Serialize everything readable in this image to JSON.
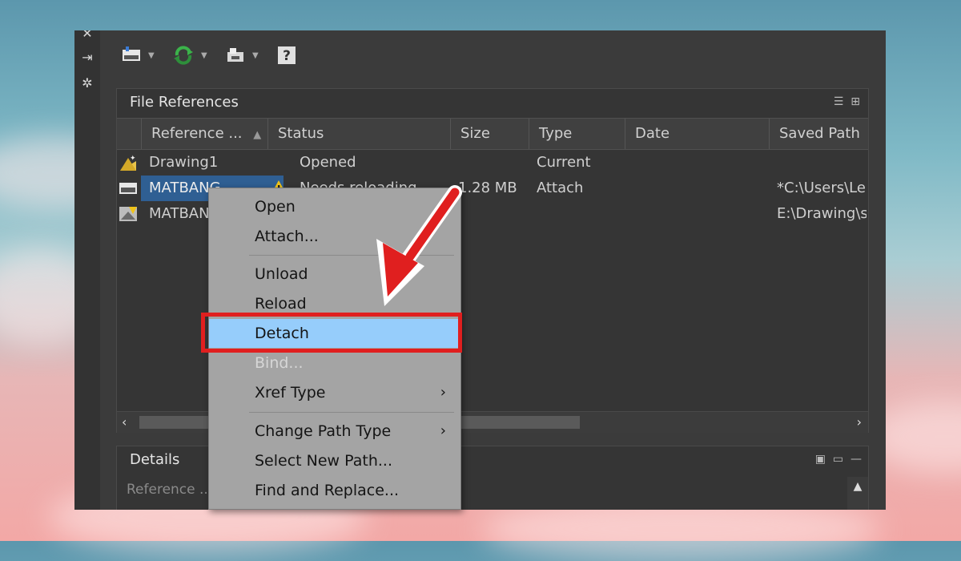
{
  "file_references": {
    "title": "File References",
    "columns": [
      "Reference ...",
      "Status",
      "Size",
      "Type",
      "Date",
      "Saved Path"
    ],
    "rows": [
      {
        "name": "Drawing1",
        "status": "Opened",
        "size": "",
        "type": "Current",
        "date": "",
        "saved_path": ""
      },
      {
        "name": "MATBANG",
        "status": "Needs reloading",
        "size": "1.28 MB",
        "type": "Attach",
        "date": "",
        "saved_path": "*C:\\Users\\Le"
      },
      {
        "name": "MATBANG",
        "status": "",
        "size": "",
        "type": "",
        "date": "",
        "saved_path": "E:\\Drawing\\s"
      }
    ]
  },
  "details": {
    "title": "Details",
    "reference_label": "Reference ..."
  },
  "context_menu": {
    "items": [
      {
        "label": "Open"
      },
      {
        "label": "Attach..."
      },
      {
        "label": "Unload"
      },
      {
        "label": "Reload"
      },
      {
        "label": "Detach",
        "highlighted": true
      },
      {
        "label": "Bind...",
        "disabled": true
      },
      {
        "label": "Xref Type",
        "submenu": "›"
      },
      {
        "label": "Change Path Type",
        "submenu": "›"
      },
      {
        "label": "Select New Path..."
      },
      {
        "label": "Find and Replace..."
      }
    ]
  },
  "colors": {
    "highlight": "#96cdfb",
    "annotation_red": "#e01f1f",
    "selection": "#2f5f93"
  }
}
